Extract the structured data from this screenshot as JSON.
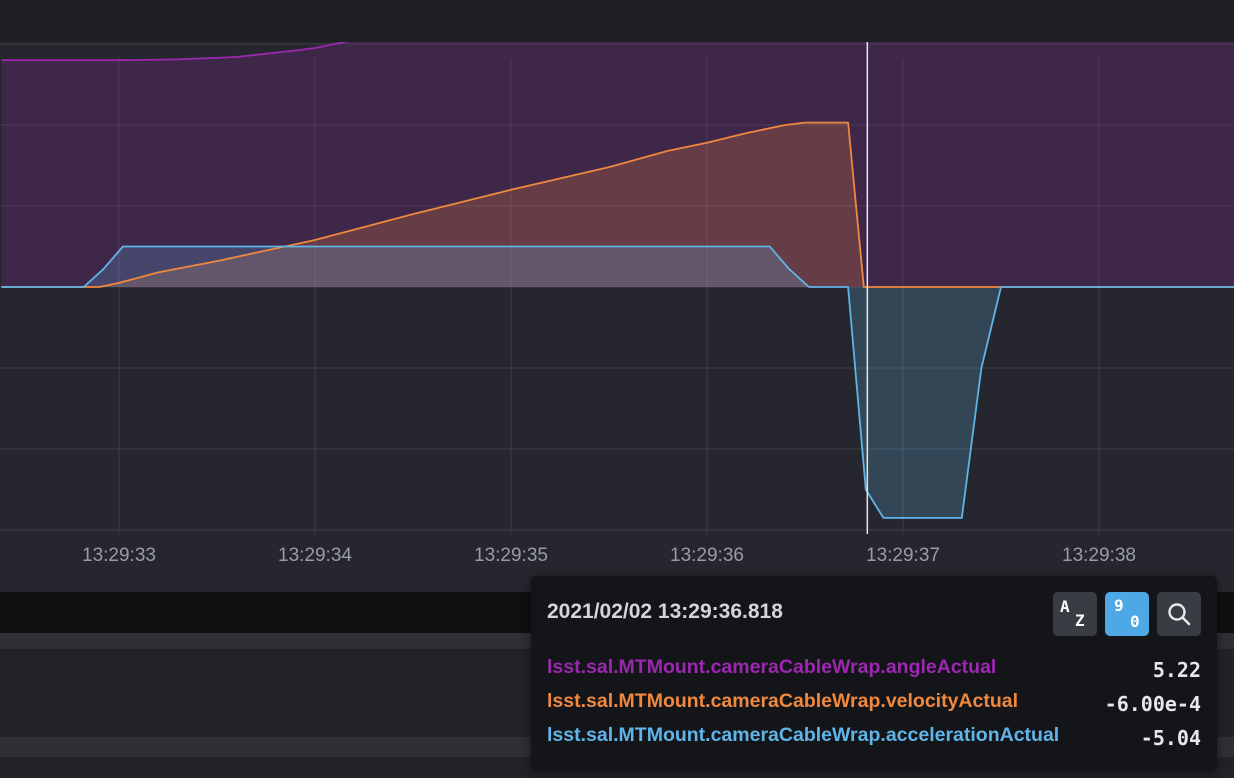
{
  "chart_data": {
    "type": "area",
    "x_ticks": [
      "13:29:33",
      "13:29:34",
      "13:29:35",
      "13:29:36",
      "13:29:37",
      "13:29:38"
    ],
    "cursor_time": "13:29:36.818",
    "series": [
      {
        "name": "lsst.sal.MTMount.cameraCableWrap.angleActual",
        "color": "#9c27b0",
        "points": [
          [
            32.4,
            2.8
          ],
          [
            32.8,
            2.8
          ],
          [
            33.0,
            2.8
          ],
          [
            33.3,
            2.81
          ],
          [
            33.6,
            2.84
          ],
          [
            33.9,
            2.92
          ],
          [
            34.0,
            2.95
          ],
          [
            34.2,
            3.05
          ],
          [
            34.4,
            3.2
          ],
          [
            34.6,
            3.38
          ],
          [
            34.8,
            3.6
          ],
          [
            35.0,
            3.88
          ],
          [
            35.2,
            4.15
          ],
          [
            35.4,
            4.38
          ],
          [
            35.6,
            4.6
          ],
          [
            35.8,
            4.95
          ],
          [
            36.0,
            5.3
          ],
          [
            36.2,
            5.6
          ],
          [
            36.4,
            5.95
          ],
          [
            36.5,
            6.15
          ],
          [
            36.6,
            6.3
          ],
          [
            36.7,
            6.4
          ],
          [
            36.78,
            6.5
          ],
          [
            36.85,
            6.5
          ],
          [
            38.7,
            6.5
          ]
        ]
      },
      {
        "name": "lsst.sal.MTMount.cameraCableWrap.velocityActual",
        "color": "#f0883e",
        "points": [
          [
            32.4,
            0
          ],
          [
            32.9,
            0
          ],
          [
            33.0,
            0.05
          ],
          [
            33.2,
            0.18
          ],
          [
            33.5,
            0.32
          ],
          [
            34.0,
            0.58
          ],
          [
            34.5,
            0.9
          ],
          [
            35.0,
            1.2
          ],
          [
            35.5,
            1.48
          ],
          [
            35.8,
            1.68
          ],
          [
            36.0,
            1.78
          ],
          [
            36.2,
            1.9
          ],
          [
            36.4,
            2.0
          ],
          [
            36.5,
            2.03
          ],
          [
            36.72,
            2.03
          ],
          [
            36.8,
            0.0
          ],
          [
            38.7,
            0.0
          ]
        ]
      },
      {
        "name": "lsst.sal.MTMount.cameraCableWrap.accelerationActual",
        "color": "#5fb4e8",
        "points": [
          [
            32.4,
            0
          ],
          [
            32.82,
            0
          ],
          [
            32.92,
            0.22
          ],
          [
            33.02,
            0.5
          ],
          [
            36.32,
            0.5
          ],
          [
            36.42,
            0.22
          ],
          [
            36.52,
            0
          ],
          [
            36.72,
            0
          ],
          [
            36.81,
            -2.5
          ],
          [
            36.9,
            -2.85
          ],
          [
            37.3,
            -2.85
          ],
          [
            37.4,
            -1.0
          ],
          [
            37.5,
            0.0
          ],
          [
            38.7,
            0.0
          ]
        ]
      }
    ]
  },
  "tooltip": {
    "timestamp": "2021/02/02 13:29:36.818",
    "sort_alpha": {
      "top": "A",
      "bottom": "Z"
    },
    "sort_value": {
      "top": "9",
      "bottom": "0"
    },
    "rows": [
      {
        "name": "lsst.sal.MTMount.cameraCableWrap.angleActual",
        "value": "5.22",
        "color": "#9c27b0"
      },
      {
        "name": "lsst.sal.MTMount.cameraCableWrap.velocityActual",
        "value": "-6.00e-4",
        "color": "#f0883e"
      },
      {
        "name": "lsst.sal.MTMount.cameraCableWrap.accelerationActual",
        "value": "-5.04",
        "color": "#5fb4e8"
      }
    ]
  }
}
